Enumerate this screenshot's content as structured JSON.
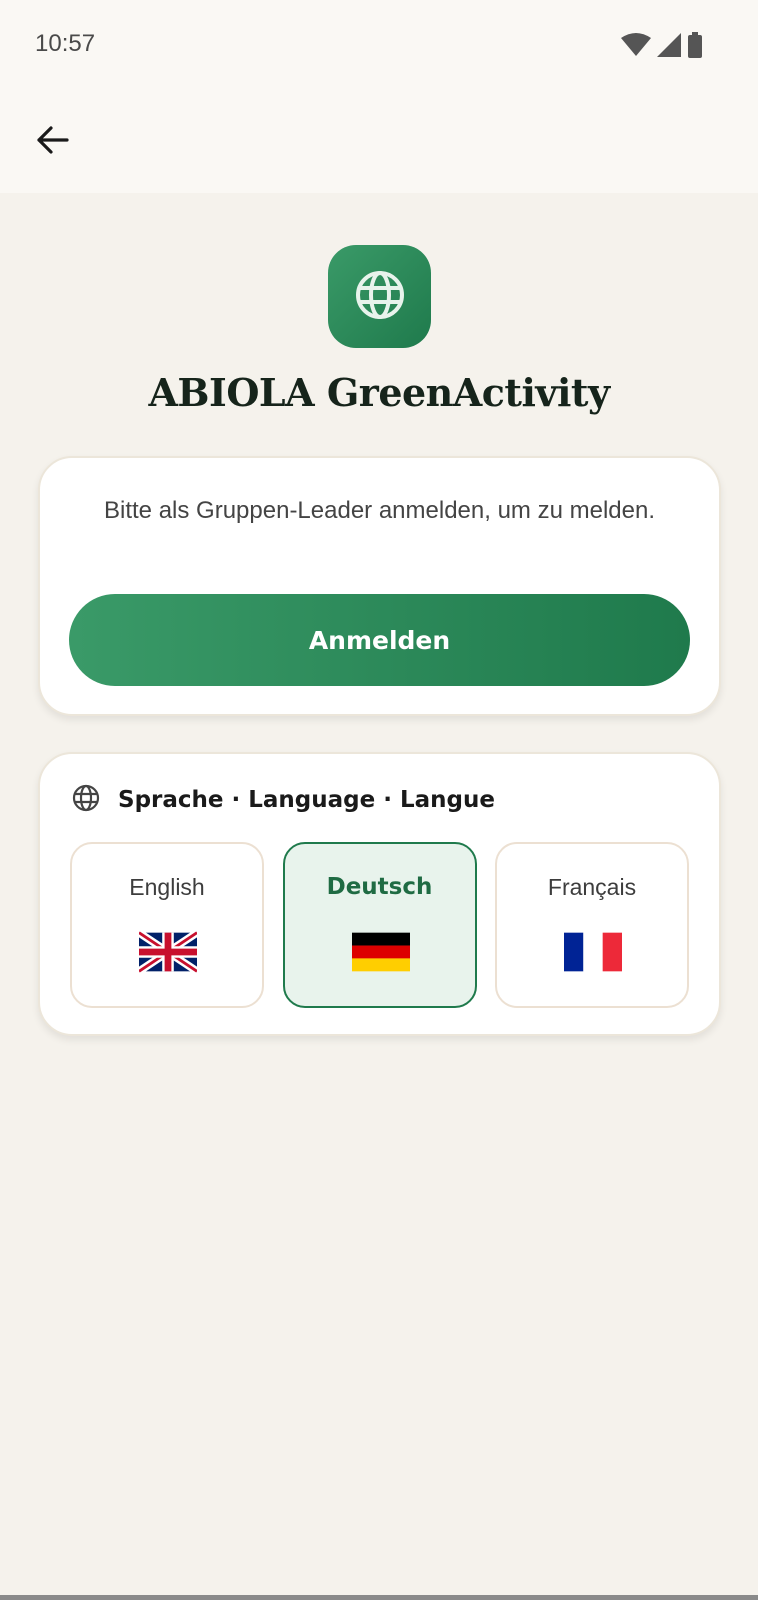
{
  "status_bar": {
    "time": "10:57",
    "icons": [
      "wifi-icon",
      "signal-icon",
      "battery-icon"
    ]
  },
  "toolbar": {
    "back_icon": "arrow-left-icon"
  },
  "app": {
    "logo_icon": "globe-icon",
    "title": "ABIOLA GreenActivity"
  },
  "login_card": {
    "message": "Bitte als Gruppen-Leader anmelden, um zu melden.",
    "button_label": "Anmelden"
  },
  "language_card": {
    "header_icon": "globe-icon",
    "header_label": "Sprache · Language · Langue",
    "options": [
      {
        "label": "English",
        "flag": "uk-flag-icon",
        "selected": false
      },
      {
        "label": "Deutsch",
        "flag": "german-flag-icon",
        "selected": true
      },
      {
        "label": "Français",
        "flag": "french-flag-icon",
        "selected": false
      }
    ]
  },
  "colors": {
    "accent": "#1f7a4c",
    "accent_light": "#3a9a68",
    "background": "#f5f2ec",
    "selected_bg": "#e8f3ec"
  }
}
